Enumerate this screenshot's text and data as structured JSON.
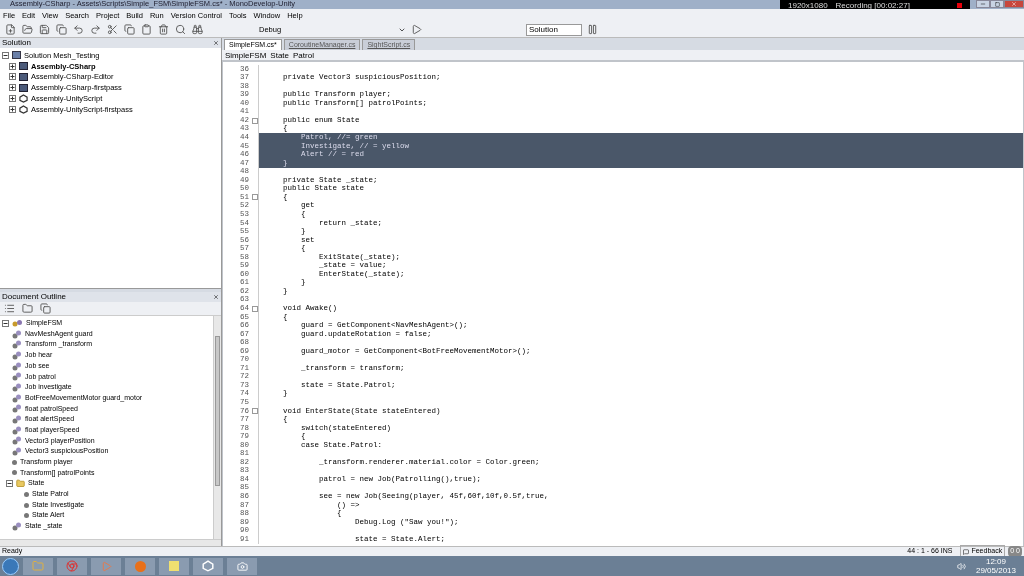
{
  "window": {
    "title": "Assembly-CSharp - Assets\\Scripts\\Simple_FSM\\SimpleFSM.cs* - MonoDevelop-Unity"
  },
  "recorder": {
    "resolution": "1920x1080",
    "status": "Recording [00:02:27]"
  },
  "menu": [
    "File",
    "Edit",
    "View",
    "Search",
    "Project",
    "Build",
    "Run",
    "Version Control",
    "Tools",
    "Window",
    "Help"
  ],
  "toolbar": {
    "configuration": "Debug",
    "target": "Solution"
  },
  "solution": {
    "title": "Solution",
    "items": [
      {
        "label": "Solution Mesh_Testing",
        "kind": "solution",
        "expanded": true,
        "children": [
          {
            "label": "Assembly-CSharp",
            "kind": "project",
            "bold": true,
            "expanded": false
          },
          {
            "label": "Assembly-CSharp-Editor",
            "kind": "project",
            "bold": false,
            "expanded": false
          },
          {
            "label": "Assembly-CSharp-firstpass",
            "kind": "project",
            "bold": false,
            "expanded": false
          },
          {
            "label": "Assembly-UnityScript",
            "kind": "unityscript",
            "bold": false,
            "expanded": false
          },
          {
            "label": "Assembly-UnityScript-firstpass",
            "kind": "unityscript",
            "bold": false,
            "expanded": false
          }
        ]
      }
    ]
  },
  "outline": {
    "title": "Document Outline",
    "items": [
      {
        "label": "SimpleFSM",
        "kind": "class",
        "expanded": true,
        "children": [
          {
            "label": "NavMeshAgent guard",
            "kind": "field"
          },
          {
            "label": "Transform _transform",
            "kind": "field"
          },
          {
            "label": "Job hear",
            "kind": "field"
          },
          {
            "label": "Job see",
            "kind": "field"
          },
          {
            "label": "Job patrol",
            "kind": "field"
          },
          {
            "label": "Job investigate",
            "kind": "field"
          },
          {
            "label": "BotFreeMovementMotor guard_motor",
            "kind": "field"
          },
          {
            "label": "float patrolSpeed",
            "kind": "field"
          },
          {
            "label": "float alertSpeed",
            "kind": "field"
          },
          {
            "label": "float playerSpeed",
            "kind": "field"
          },
          {
            "label": "Vector3 playerPosition",
            "kind": "field"
          },
          {
            "label": "Vector3 suspiciousPosition",
            "kind": "field"
          },
          {
            "label": "Transform player",
            "kind": "member"
          },
          {
            "label": "Transform[] patrolPoints",
            "kind": "member"
          },
          {
            "label": "State",
            "kind": "enum",
            "expanded": true,
            "children": [
              {
                "label": "State Patrol",
                "kind": "member"
              },
              {
                "label": "State Investigate",
                "kind": "member"
              },
              {
                "label": "State Alert",
                "kind": "member"
              }
            ]
          },
          {
            "label": "State _state",
            "kind": "field"
          }
        ]
      }
    ]
  },
  "tabs": [
    {
      "label": "SimpleFSM.cs*",
      "selected": true
    },
    {
      "label": "CoroutineManager.cs",
      "selected": false
    },
    {
      "label": "SightScript.cs",
      "selected": false
    }
  ],
  "breadcrumb": [
    "SimpleFSM",
    "State",
    "Patrol"
  ],
  "code": [
    {
      "n": "36",
      "fold": false,
      "selected": false
    },
    {
      "n": "37",
      "text": "    private Vector3 suspiciousPosition;",
      "fold": false,
      "selected": false
    },
    {
      "n": "38",
      "fold": false,
      "selected": false
    },
    {
      "n": "39",
      "text": "    public Transform player;",
      "fold": false,
      "selected": false
    },
    {
      "n": "40",
      "text": "    public Transform[] patrolPoints;",
      "fold": false,
      "selected": false
    },
    {
      "n": "41",
      "fold": false,
      "selected": false
    },
    {
      "n": "42",
      "text": "    public enum State",
      "fold": true,
      "selected": false
    },
    {
      "n": "43",
      "text": "    {",
      "fold": false,
      "selected": false
    },
    {
      "n": "44",
      "text": "        Patrol, //= green",
      "fold": false,
      "selected": true
    },
    {
      "n": "45",
      "text": "        Investigate, // = yellow",
      "fold": false,
      "selected": true
    },
    {
      "n": "46",
      "text": "        Alert // = red",
      "fold": false,
      "selected": true
    },
    {
      "n": "47",
      "text": "    }",
      "fold": false,
      "selected": true
    },
    {
      "n": "48",
      "fold": false,
      "selected": false
    },
    {
      "n": "49",
      "text": "    private State _state;",
      "fold": false,
      "selected": false
    },
    {
      "n": "50",
      "text": "    public State state",
      "fold": false,
      "selected": false
    },
    {
      "n": "51",
      "text": "    {",
      "fold": true,
      "selected": false
    },
    {
      "n": "52",
      "text": "        get",
      "fold": false,
      "selected": false
    },
    {
      "n": "53",
      "text": "        {",
      "fold": false,
      "selected": false
    },
    {
      "n": "54",
      "text": "            return _state;",
      "fold": false,
      "selected": false
    },
    {
      "n": "55",
      "text": "        }",
      "fold": false,
      "selected": false
    },
    {
      "n": "56",
      "text": "        set",
      "fold": false,
      "selected": false
    },
    {
      "n": "57",
      "text": "        {",
      "fold": false,
      "selected": false
    },
    {
      "n": "58",
      "text": "            ExitState(_state);",
      "fold": false,
      "selected": false
    },
    {
      "n": "59",
      "text": "            _state = value;",
      "fold": false,
      "selected": false
    },
    {
      "n": "60",
      "text": "            EnterState(_state);",
      "fold": false,
      "selected": false
    },
    {
      "n": "61",
      "text": "        }",
      "fold": false,
      "selected": false
    },
    {
      "n": "62",
      "text": "    }",
      "fold": false,
      "selected": false
    },
    {
      "n": "63",
      "fold": false,
      "selected": false
    },
    {
      "n": "64",
      "text": "    void Awake()",
      "fold": true,
      "selected": false
    },
    {
      "n": "65",
      "text": "    {",
      "fold": false,
      "selected": false
    },
    {
      "n": "66",
      "text": "        guard = GetComponent<NavMeshAgent>();",
      "fold": false,
      "selected": false
    },
    {
      "n": "67",
      "text": "        guard.updateRotation = false;",
      "fold": false,
      "selected": false
    },
    {
      "n": "68",
      "fold": false,
      "selected": false
    },
    {
      "n": "69",
      "text": "        guard_motor = GetComponent<BotFreeMovementMotor>();",
      "fold": false,
      "selected": false
    },
    {
      "n": "70",
      "fold": false,
      "selected": false
    },
    {
      "n": "71",
      "text": "        _transform = transform;",
      "fold": false,
      "selected": false
    },
    {
      "n": "72",
      "fold": false,
      "selected": false
    },
    {
      "n": "73",
      "text": "        state = State.Patrol;",
      "fold": false,
      "selected": false
    },
    {
      "n": "74",
      "text": "    }",
      "fold": false,
      "selected": false
    },
    {
      "n": "75",
      "fold": false,
      "selected": false
    },
    {
      "n": "76",
      "text": "    void EnterState(State stateEntered)",
      "fold": true,
      "selected": false
    },
    {
      "n": "77",
      "text": "    {",
      "fold": false,
      "selected": false
    },
    {
      "n": "78",
      "text": "        switch(stateEntered)",
      "fold": false,
      "selected": false
    },
    {
      "n": "79",
      "text": "        {",
      "fold": false,
      "selected": false
    },
    {
      "n": "80",
      "text": "        case State.Patrol:",
      "fold": false,
      "selected": false
    },
    {
      "n": "81",
      "fold": false,
      "selected": false
    },
    {
      "n": "82",
      "text": "            _transform.renderer.material.color = Color.green;",
      "fold": false,
      "selected": false
    },
    {
      "n": "83",
      "fold": false,
      "selected": false
    },
    {
      "n": "84",
      "text": "            patrol = new Job(Patrolling(),true);",
      "fold": false,
      "selected": false
    },
    {
      "n": "85",
      "fold": false,
      "selected": false
    },
    {
      "n": "86",
      "text": "            see = new Job(Seeing(player, 45f,60f,10f,0.5f,true,",
      "fold": false,
      "selected": false
    },
    {
      "n": "87",
      "text": "                () =>",
      "fold": false,
      "selected": false
    },
    {
      "n": "88",
      "text": "                {",
      "fold": false,
      "selected": false
    },
    {
      "n": "89",
      "text": "                    Debug.Log (\"Saw you!\");",
      "fold": false,
      "selected": false
    },
    {
      "n": "90",
      "fold": false,
      "selected": false
    },
    {
      "n": "91",
      "text": "                    state = State.Alert;",
      "fold": false,
      "selected": false
    }
  ],
  "status_bar": {
    "message": "Ready",
    "position": "44 : 1 - 66 INS",
    "feedback": "Feedback",
    "errors": "0",
    "warnings": "0"
  },
  "taskbar": {
    "time": "12:09",
    "date": "29/05/2013"
  }
}
